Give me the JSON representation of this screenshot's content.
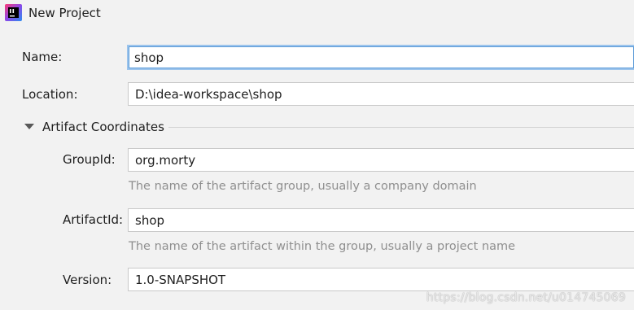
{
  "window": {
    "title": "New Project",
    "icon": "intellij-idea-icon"
  },
  "form": {
    "name": {
      "label": "Name:",
      "value": "shop"
    },
    "location": {
      "label": "Location:",
      "value": "D:\\idea-workspace\\shop"
    }
  },
  "artifact": {
    "section_title": "Artifact Coordinates",
    "expanded": true,
    "group_id": {
      "label": "GroupId:",
      "value": "org.morty",
      "hint": "The name of the artifact group, usually a company domain"
    },
    "artifact_id": {
      "label": "ArtifactId:",
      "value": "shop",
      "hint": "The name of the artifact within the group, usually a project name"
    },
    "version": {
      "label": "Version:",
      "value": "1.0-SNAPSHOT"
    }
  },
  "watermark": "https://blog.csdn.net/u014745069",
  "colors": {
    "background": "#f2f2f2",
    "field_background": "#ffffff",
    "focus_border": "#5b9bd8",
    "hint_text": "#8f8f8f"
  }
}
